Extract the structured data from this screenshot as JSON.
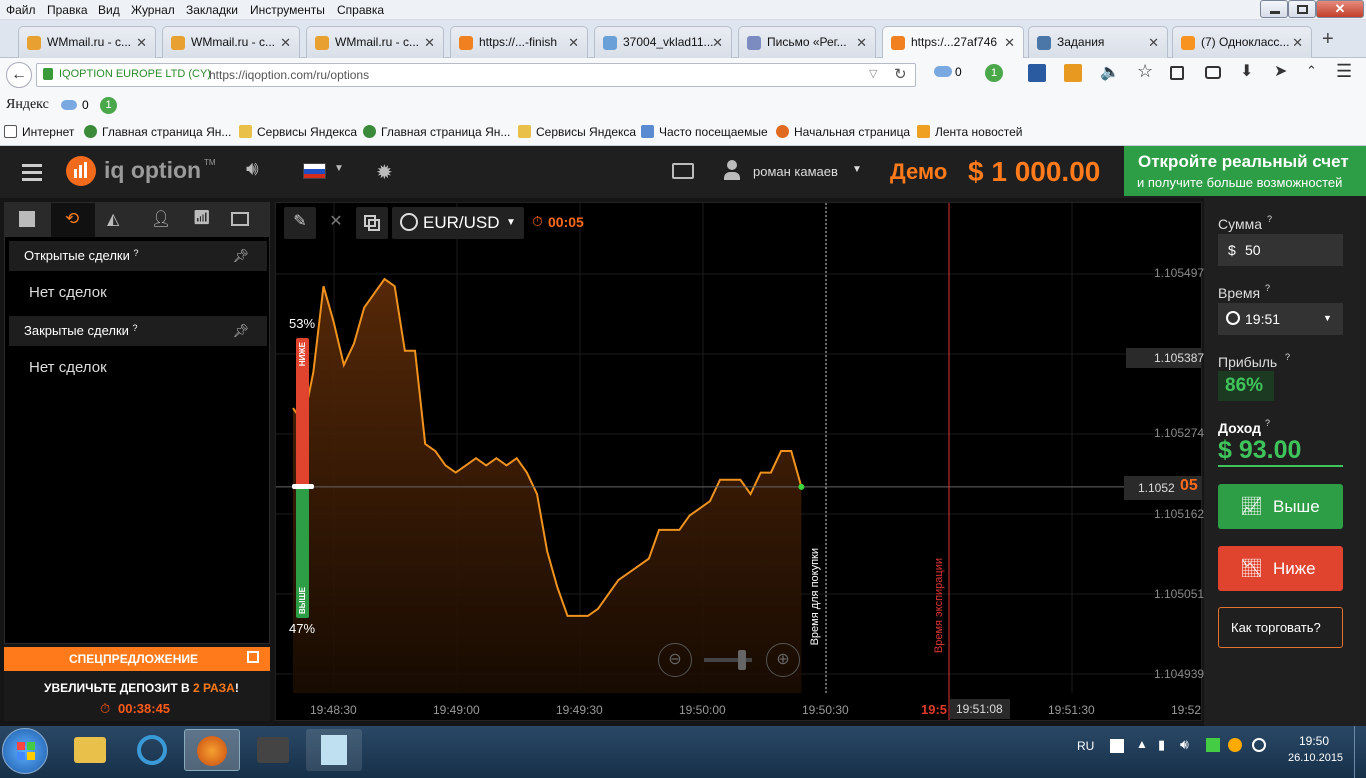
{
  "browser": {
    "menu": [
      "Файл",
      "Правка",
      "Вид",
      "Журнал",
      "Закладки",
      "Инструменты",
      "Справка"
    ],
    "tabs": [
      {
        "title": "WMmail.ru - с...",
        "fav": "#e8a030"
      },
      {
        "title": "WMmail.ru - с...",
        "fav": "#e8a030"
      },
      {
        "title": "WMmail.ru - с...",
        "fav": "#e8a030"
      },
      {
        "title": "https://...-finish",
        "fav": "#f08020"
      },
      {
        "title": "37004_vklad11...",
        "fav": "#6aa0d8"
      },
      {
        "title": "Письмо «Рег...",
        "fav": "#7c8cc0"
      },
      {
        "title": "https:/...27af746",
        "fav": "#f08020"
      },
      {
        "title": "Задания",
        "fav": "#4a76a8"
      },
      {
        "title": "(7) Однокласс...",
        "fav": "#f7931e"
      }
    ],
    "identity": "IQOPTION EUROPE LTD (CY)",
    "url": "https://iqoption.com/ru/options",
    "cloud_count": "0",
    "badge_count": "1",
    "yandex_logo": "Яндекс",
    "yandex_cloud_count": "0",
    "yandex_badge": "1",
    "bookmarks": [
      {
        "label": "Интернет",
        "color": "#ffffff"
      },
      {
        "label": "Главная страница Ян...",
        "color": "#3a8a3a"
      },
      {
        "label": "Сервисы Яндекса",
        "color": "#e8c04a"
      },
      {
        "label": "Главная страница Ян...",
        "color": "#3a8a3a"
      },
      {
        "label": "Сервисы Яндекса",
        "color": "#e8c04a"
      },
      {
        "label": "Часто посещаемые",
        "color": "#5a8ad0"
      },
      {
        "label": "Начальная страница",
        "color": "#e06a20"
      },
      {
        "label": "Лента новостей",
        "color": "#f0a020"
      }
    ]
  },
  "header": {
    "logo_text": "iq option",
    "logo_tm": "TM",
    "user_name": "роман камаев",
    "mode_label": "Демо",
    "balance": "$ 1 000.00",
    "cta_title": "Откройте реальный счет",
    "cta_subtitle": "и получите больше возможностей"
  },
  "left_panel": {
    "open_deals_title": "Открытые сделки",
    "open_deals_empty": "Нет сделок",
    "closed_deals_title": "Закрытые сделки",
    "closed_deals_empty": "Нет сделок",
    "promo_title": "СПЕЦПРЕДЛОЖЕНИЕ",
    "promo_text_pre": "УВЕЛИЧЬТЕ ДЕПОЗИТ В ",
    "promo_highlight": "2 РАЗА",
    "promo_text_post": "!",
    "promo_timer": "00:38:45"
  },
  "chart_toolbar": {
    "asset": "EUR/USD",
    "timer": "00:05"
  },
  "sentiment": {
    "lower_pct": "53%",
    "higher_pct": "47%",
    "lower_label": "НИЖЕ",
    "higher_label": "ВЫШЕ",
    "lower_value": 53
  },
  "chart_data": {
    "type": "area",
    "series": [
      {
        "values": [
          1.10531,
          1.10529,
          1.10536,
          1.10548,
          1.10543,
          1.10537,
          1.1054,
          1.10545,
          1.10547,
          1.10549,
          1.10548,
          1.10539,
          1.10539,
          1.10526,
          1.10525,
          1.10523,
          1.10522,
          1.10523,
          1.10524,
          1.10523,
          1.10524,
          1.10523,
          1.10524,
          1.10522,
          1.10519,
          1.10511,
          1.10506,
          1.10502,
          1.10502,
          1.10502,
          1.10503,
          1.10505,
          1.10507,
          1.10508,
          1.10509,
          1.1051,
          1.10514,
          1.10514,
          1.10514,
          1.10516,
          1.10517,
          1.10518,
          1.10521,
          1.10521,
          1.10521,
          1.10519,
          1.10522,
          1.10522,
          1.10525,
          1.10525,
          1.1052
        ]
      }
    ],
    "x_start": "19:48:20",
    "x_end": "19:50:24",
    "x_ticks": [
      "19:48:30",
      "19:49:00",
      "19:49:30",
      "19:50:00",
      "19:50:30",
      "19:51:00",
      "19:51:30",
      "19:52"
    ],
    "y_ticks": [
      "1.105497",
      "1.105387",
      "1.105274",
      "1.105162",
      "1.105051",
      "1.104939"
    ],
    "current_price_main": "1.1052",
    "current_price_tail": "05",
    "purchase_label": "Время для покупки",
    "expiration_label": "Время экспирации",
    "expiry_time_label": "19:5",
    "expiry_time_full": "19:51:08"
  },
  "right_panel": {
    "amount_label": "Сумма",
    "amount_currency": "$",
    "amount_value": "50",
    "time_label": "Время",
    "time_value": "19:51",
    "profit_label": "Прибыль",
    "profit_value": "86%",
    "income_label": "Доход",
    "income_value": "$ 93.00",
    "higher_button": "Выше",
    "lower_button": "Ниже",
    "howto_button": "Как торговать?"
  },
  "taskbar": {
    "lang": "RU",
    "time": "19:50",
    "date": "26.10.2015"
  }
}
